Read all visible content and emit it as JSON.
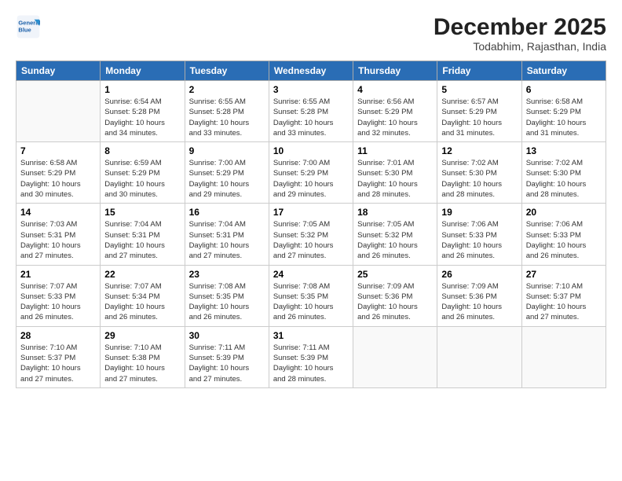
{
  "logo": {
    "line1": "General",
    "line2": "Blue"
  },
  "title": "December 2025",
  "location": "Todabhim, Rajasthan, India",
  "weekdays": [
    "Sunday",
    "Monday",
    "Tuesday",
    "Wednesday",
    "Thursday",
    "Friday",
    "Saturday"
  ],
  "weeks": [
    [
      {
        "day": "",
        "info": ""
      },
      {
        "day": "1",
        "info": "Sunrise: 6:54 AM\nSunset: 5:28 PM\nDaylight: 10 hours\nand 34 minutes."
      },
      {
        "day": "2",
        "info": "Sunrise: 6:55 AM\nSunset: 5:28 PM\nDaylight: 10 hours\nand 33 minutes."
      },
      {
        "day": "3",
        "info": "Sunrise: 6:55 AM\nSunset: 5:28 PM\nDaylight: 10 hours\nand 33 minutes."
      },
      {
        "day": "4",
        "info": "Sunrise: 6:56 AM\nSunset: 5:29 PM\nDaylight: 10 hours\nand 32 minutes."
      },
      {
        "day": "5",
        "info": "Sunrise: 6:57 AM\nSunset: 5:29 PM\nDaylight: 10 hours\nand 31 minutes."
      },
      {
        "day": "6",
        "info": "Sunrise: 6:58 AM\nSunset: 5:29 PM\nDaylight: 10 hours\nand 31 minutes."
      }
    ],
    [
      {
        "day": "7",
        "info": "Sunrise: 6:58 AM\nSunset: 5:29 PM\nDaylight: 10 hours\nand 30 minutes."
      },
      {
        "day": "8",
        "info": "Sunrise: 6:59 AM\nSunset: 5:29 PM\nDaylight: 10 hours\nand 30 minutes."
      },
      {
        "day": "9",
        "info": "Sunrise: 7:00 AM\nSunset: 5:29 PM\nDaylight: 10 hours\nand 29 minutes."
      },
      {
        "day": "10",
        "info": "Sunrise: 7:00 AM\nSunset: 5:29 PM\nDaylight: 10 hours\nand 29 minutes."
      },
      {
        "day": "11",
        "info": "Sunrise: 7:01 AM\nSunset: 5:30 PM\nDaylight: 10 hours\nand 28 minutes."
      },
      {
        "day": "12",
        "info": "Sunrise: 7:02 AM\nSunset: 5:30 PM\nDaylight: 10 hours\nand 28 minutes."
      },
      {
        "day": "13",
        "info": "Sunrise: 7:02 AM\nSunset: 5:30 PM\nDaylight: 10 hours\nand 28 minutes."
      }
    ],
    [
      {
        "day": "14",
        "info": "Sunrise: 7:03 AM\nSunset: 5:31 PM\nDaylight: 10 hours\nand 27 minutes."
      },
      {
        "day": "15",
        "info": "Sunrise: 7:04 AM\nSunset: 5:31 PM\nDaylight: 10 hours\nand 27 minutes."
      },
      {
        "day": "16",
        "info": "Sunrise: 7:04 AM\nSunset: 5:31 PM\nDaylight: 10 hours\nand 27 minutes."
      },
      {
        "day": "17",
        "info": "Sunrise: 7:05 AM\nSunset: 5:32 PM\nDaylight: 10 hours\nand 27 minutes."
      },
      {
        "day": "18",
        "info": "Sunrise: 7:05 AM\nSunset: 5:32 PM\nDaylight: 10 hours\nand 26 minutes."
      },
      {
        "day": "19",
        "info": "Sunrise: 7:06 AM\nSunset: 5:33 PM\nDaylight: 10 hours\nand 26 minutes."
      },
      {
        "day": "20",
        "info": "Sunrise: 7:06 AM\nSunset: 5:33 PM\nDaylight: 10 hours\nand 26 minutes."
      }
    ],
    [
      {
        "day": "21",
        "info": "Sunrise: 7:07 AM\nSunset: 5:33 PM\nDaylight: 10 hours\nand 26 minutes."
      },
      {
        "day": "22",
        "info": "Sunrise: 7:07 AM\nSunset: 5:34 PM\nDaylight: 10 hours\nand 26 minutes."
      },
      {
        "day": "23",
        "info": "Sunrise: 7:08 AM\nSunset: 5:35 PM\nDaylight: 10 hours\nand 26 minutes."
      },
      {
        "day": "24",
        "info": "Sunrise: 7:08 AM\nSunset: 5:35 PM\nDaylight: 10 hours\nand 26 minutes."
      },
      {
        "day": "25",
        "info": "Sunrise: 7:09 AM\nSunset: 5:36 PM\nDaylight: 10 hours\nand 26 minutes."
      },
      {
        "day": "26",
        "info": "Sunrise: 7:09 AM\nSunset: 5:36 PM\nDaylight: 10 hours\nand 26 minutes."
      },
      {
        "day": "27",
        "info": "Sunrise: 7:10 AM\nSunset: 5:37 PM\nDaylight: 10 hours\nand 27 minutes."
      }
    ],
    [
      {
        "day": "28",
        "info": "Sunrise: 7:10 AM\nSunset: 5:37 PM\nDaylight: 10 hours\nand 27 minutes."
      },
      {
        "day": "29",
        "info": "Sunrise: 7:10 AM\nSunset: 5:38 PM\nDaylight: 10 hours\nand 27 minutes."
      },
      {
        "day": "30",
        "info": "Sunrise: 7:11 AM\nSunset: 5:39 PM\nDaylight: 10 hours\nand 27 minutes."
      },
      {
        "day": "31",
        "info": "Sunrise: 7:11 AM\nSunset: 5:39 PM\nDaylight: 10 hours\nand 28 minutes."
      },
      {
        "day": "",
        "info": ""
      },
      {
        "day": "",
        "info": ""
      },
      {
        "day": "",
        "info": ""
      }
    ]
  ]
}
